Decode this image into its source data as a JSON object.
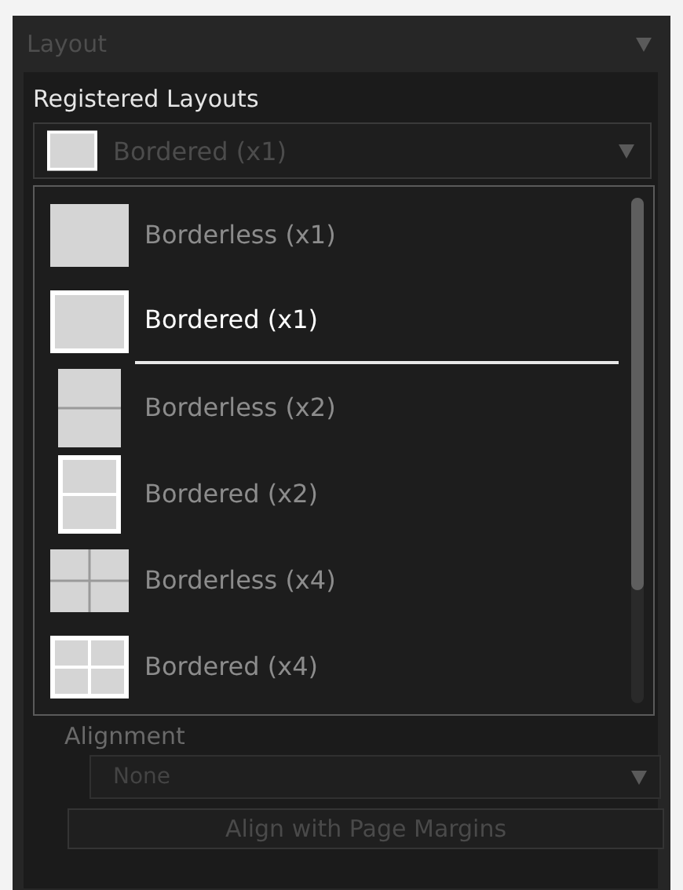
{
  "panel": {
    "title": "Layout"
  },
  "registered_layouts": {
    "label": "Registered Layouts",
    "dropdown": {
      "value": "Bordered (x1)",
      "kind": "bordered-single"
    },
    "options": [
      {
        "label": "Borderless (x1)",
        "kind": "borderless-single",
        "selected": false
      },
      {
        "label": "Bordered (x1)",
        "kind": "bordered-single",
        "selected": true
      },
      {
        "label": "Borderless (x2)",
        "kind": "borderless-double",
        "selected": false
      },
      {
        "label": "Bordered (x2)",
        "kind": "bordered-double",
        "selected": false
      },
      {
        "label": "Borderless (x4)",
        "kind": "borderless-quad",
        "selected": false
      },
      {
        "label": "Bordered (x4)",
        "kind": "bordered-quad",
        "selected": false
      }
    ]
  },
  "alignment": {
    "label": "Alignment",
    "dropdown": {
      "value": "None"
    },
    "button": "Align with Page Margins"
  }
}
